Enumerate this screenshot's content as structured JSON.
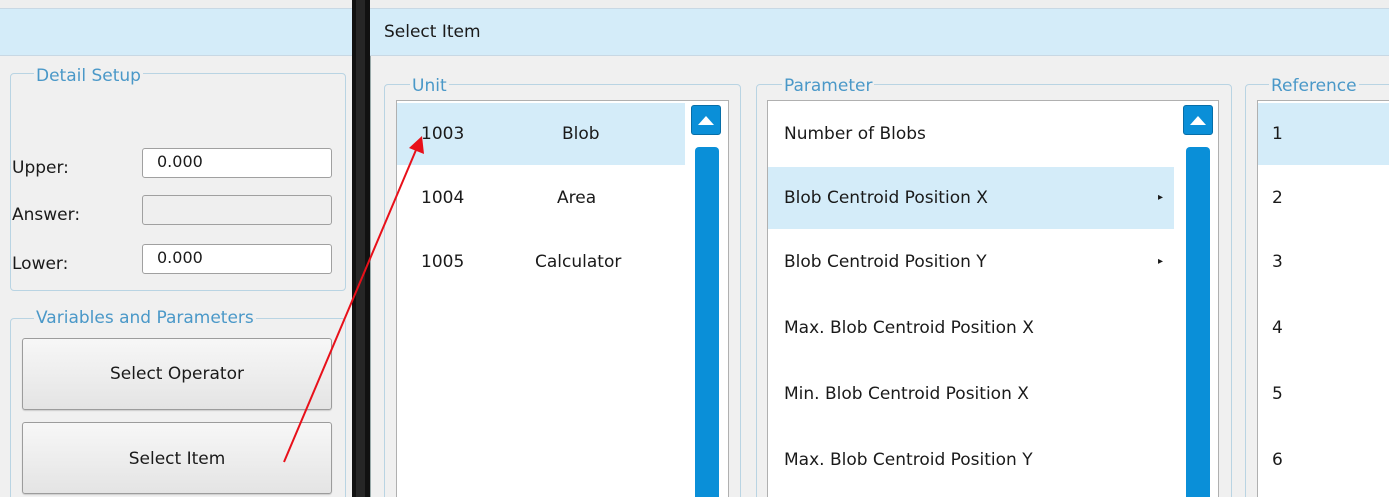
{
  "left": {
    "detail_setup": {
      "title": "Detail Setup",
      "upper_label": "Upper:",
      "upper_value": "0.000",
      "answer_label": "Answer:",
      "answer_value": "",
      "lower_label": "Lower:",
      "lower_value": "0.000"
    },
    "variables": {
      "title": "Variables and Parameters",
      "select_operator_label": "Select Operator",
      "select_item_label": "Select Item"
    }
  },
  "right": {
    "header_title": "Select Item",
    "unit": {
      "title": "Unit",
      "rows": [
        {
          "id": "1003",
          "name": "Blob",
          "selected": true
        },
        {
          "id": "1004",
          "name": "Area",
          "selected": false
        },
        {
          "id": "1005",
          "name": "Calculator",
          "selected": false
        }
      ]
    },
    "parameter": {
      "title": "Parameter",
      "rows": [
        {
          "label": "Number of Blobs",
          "submenu": false
        },
        {
          "label": "Blob Centroid Position X",
          "submenu": true
        },
        {
          "label": "Blob Centroid Position Y",
          "submenu": true
        },
        {
          "label": "Max. Blob Centroid Position X",
          "submenu": false
        },
        {
          "label": "Min. Blob Centroid Position X",
          "submenu": false
        },
        {
          "label": "Max. Blob Centroid Position Y",
          "submenu": false
        }
      ]
    },
    "reference": {
      "title": "Reference",
      "rows": [
        "1",
        "2",
        "3",
        "4",
        "5",
        "6"
      ]
    }
  },
  "annotation": {
    "arrow_color": "#e8101a"
  },
  "colors": {
    "header_bg": "#d4ecf9",
    "accent_blue": "#0a8fd8",
    "group_title": "#4a98c8",
    "selected_row": "#d4ecf9"
  }
}
